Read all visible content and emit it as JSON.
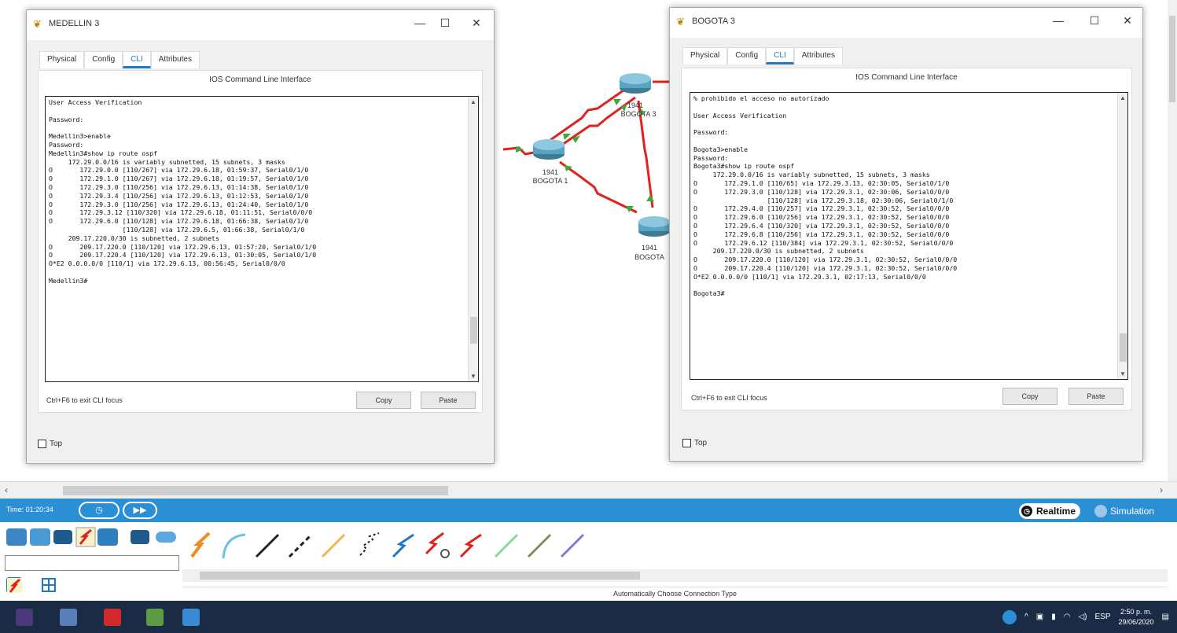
{
  "windows": {
    "medellin": {
      "title": "MEDELLIN 3",
      "tabs": [
        "Physical",
        "Config",
        "CLI",
        "Attributes"
      ],
      "active_tab": "CLI",
      "panel_title": "IOS Command Line Interface",
      "terminal_text": "User Access Verification\n\nPassword:\n\nMedellin3>enable\nPassword:\nMedellin3#show ip route ospf\n     172.29.0.0/16 is variably subnetted, 15 subnets, 3 masks\nO       172.29.0.0 [110/267] via 172.29.6.18, 01:59:37, Serial0/1/0\nO       172.29.1.0 [110/267] via 172.29.6.18, 01:19:57, Serial0/1/0\nO       172.29.3.0 [110/256] via 172.29.6.13, 01:14:38, Serial0/1/0\nO       172.29.3.4 [110/256] via 172.29.6.13, 01:12:53, Serial0/1/0\nO       172.29.3.0 [110/256] via 172.29.6.13, 01:24:40, Serial0/1/0\nO       172.29.3.12 [110/320] via 172.29.6.18, 01:11:51, Serial0/0/0\nO       172.29.6.0 [110/128] via 172.29.6.18, 01:66:38, Serial0/1/0\n                   [110/128] via 172.29.6.5, 01:66:38, Serial0/1/0\n     209.17.220.0/30 is subnetted, 2 subnets\nO       209.17.220.0 [110/120] via 172.29.6.13, 01:57:20, Serial0/1/0\nO       209.17.220.4 [110/120] via 172.29.6.13, 01:30:05, Serial0/1/0\nO*E2 0.0.0.0/0 [110/1] via 172.29.6.13, 00:56:45, Serial0/0/0\n\nMedellin3#",
      "hint": "Ctrl+F6 to exit CLI focus",
      "copy_label": "Copy",
      "paste_label": "Paste",
      "top_label": "Top",
      "controls": [
        "—",
        "☐",
        "✕"
      ]
    },
    "bogota": {
      "title": "BOGOTA 3",
      "tabs": [
        "Physical",
        "Config",
        "CLI",
        "Attributes"
      ],
      "active_tab": "CLI",
      "panel_title": "IOS Command Line Interface",
      "terminal_text": "% prohibido el acceso no autorizado\n\nUser Access Verification\n\nPassword:\n\nBogota3>enable\nPassword:\nBogota3#show ip route ospf\n     172.29.0.0/16 is variably subnetted, 15 subnets, 3 masks\nO       172.29.1.0 [110/65] via 172.29.3.13, 02:30:05, Serial0/1/0\nO       172.29.3.0 [110/128] via 172.29.3.1, 02:30:06, Serial0/0/0\n                   [110/128] via 172.29.3.18, 02:30:06, Serial0/1/0\nO       172.29.4.0 [110/257] via 172.29.3.1, 02:30:52, Serial0/0/0\nO       172.29.6.0 [110/256] via 172.29.3.1, 02:30:52, Serial0/0/0\nO       172.29.6.4 [110/320] via 172.29.3.1, 02:30:52, Serial0/0/0\nO       172.29.6.8 [110/256] via 172.29.3.1, 02:30:52, Serial0/0/0\nO       172.29.6.12 [110/384] via 172.29.3.1, 02:30:52, Serial0/0/0\n     209.17.220.0/30 is subnetted, 2 subnets\nO       209.17.220.0 [110/120] via 172.29.3.1, 02:30:52, Serial0/0/0\nO       209.17.220.4 [110/120] via 172.29.3.1, 02:30:52, Serial0/0/0\nO*E2 0.0.0.0/0 [110/1] via 172.29.3.1, 02:17:13, Serial0/0/0\n\nBogota3#",
      "hint": "Ctrl+F6 to exit CLI focus",
      "copy_label": "Copy",
      "paste_label": "Paste",
      "top_label": "Top",
      "controls": [
        "—",
        "☐",
        "✕"
      ]
    }
  },
  "topology": {
    "devices": [
      {
        "model": "1941",
        "name": "BOGOTA 3"
      },
      {
        "model": "1941",
        "name": "BOGOTA 1"
      },
      {
        "model": "1941",
        "name": "BOGOTA"
      }
    ],
    "link_color": "#e0221e",
    "endpoint_color": "#3caa3c"
  },
  "bottom": {
    "time": "Time: 01:20:34",
    "realtime_label": "Realtime",
    "simulation_label": "Simulation",
    "connection_type_label": "Automatically Choose Connection Type",
    "accent": "#2b8fd6"
  },
  "taskbar": {
    "tray_lang": "ESP",
    "clock_time": "2:50 p. m.",
    "clock_date": "29/06/2020",
    "tray_icons": [
      "help-icon",
      "chevron-up-icon",
      "network-icon",
      "battery-icon",
      "wifi-icon",
      "volume-icon"
    ]
  }
}
